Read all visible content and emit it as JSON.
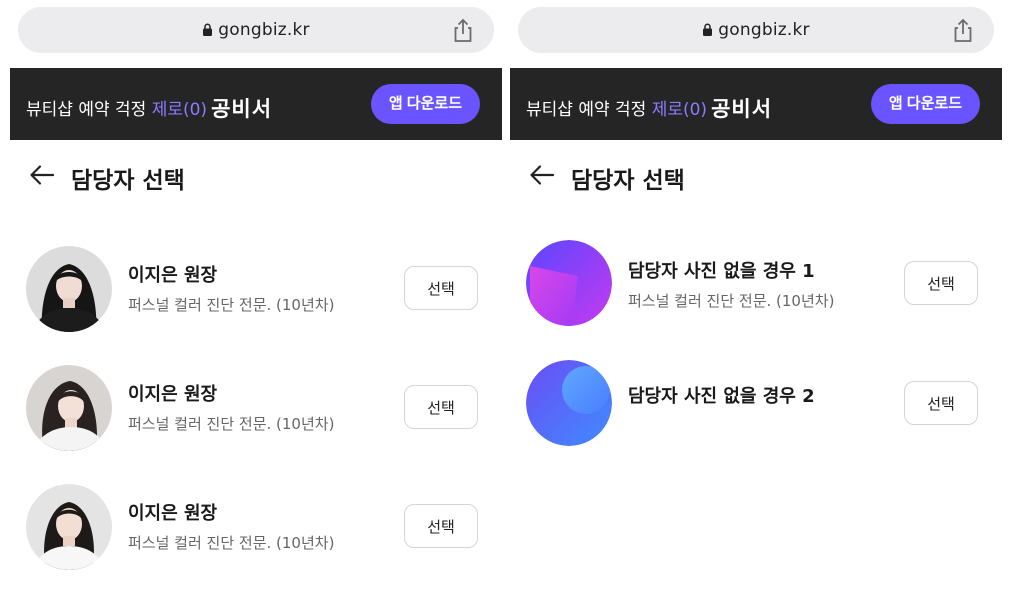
{
  "browser": {
    "url": "gongbiz.kr",
    "lock_icon": "lock-icon",
    "share_icon": "share-icon"
  },
  "banner": {
    "text_prefix": "뷰티샵 예약 걱정 ",
    "text_highlight": "제로(0)",
    "brand": "공비서",
    "app_button": "앱 다운로드",
    "colors": {
      "background": "#252525",
      "highlight": "#8a7bff",
      "button": "#6a54ff"
    }
  },
  "header": {
    "title": "담당자 선택",
    "back_icon": "arrow-left-icon"
  },
  "left": {
    "staff": [
      {
        "name": "이지은 원장",
        "desc": "퍼스널 컬러 진단 전문. (10년차)",
        "button": "선택"
      },
      {
        "name": "이지은 원장",
        "desc": "퍼스널 컬러 진단 전문. (10년차)",
        "button": "선택"
      },
      {
        "name": "이지은 원장",
        "desc": "퍼스널 컬러 진단 전문. (10년차)",
        "button": "선택"
      }
    ]
  },
  "right": {
    "staff": [
      {
        "name": "담당자 사진 없을 경우 1",
        "desc": "퍼스널 컬러 진단 전문. (10년차)",
        "button": "선택"
      },
      {
        "name": "담당자 사진 없을 경우 2",
        "desc": "",
        "button": "선택"
      }
    ]
  }
}
